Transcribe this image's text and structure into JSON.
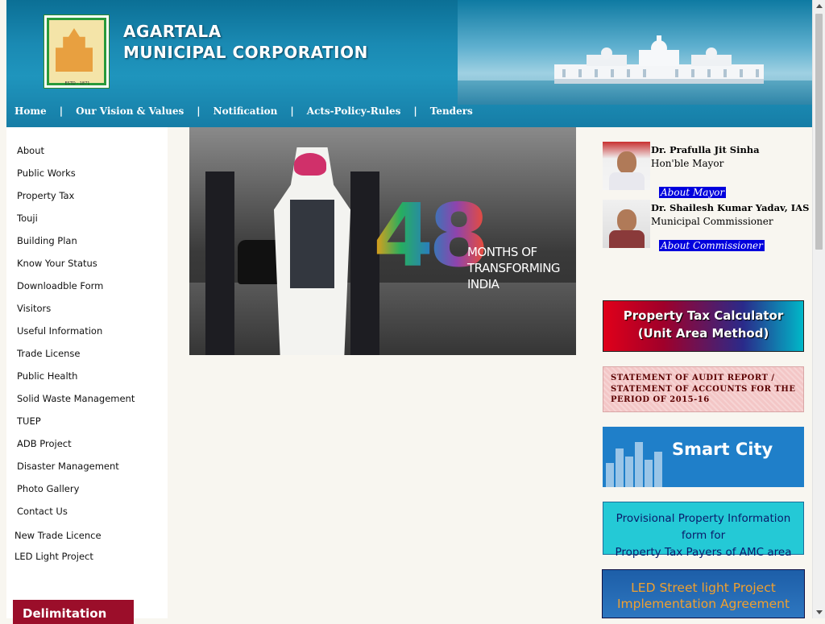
{
  "header": {
    "title_line1": "AGARTALA",
    "title_line2": "MUNICIPAL CORPORATION",
    "logo_estd": "ESTD - 1871"
  },
  "topnav": [
    "Home",
    "Our Vision & Values",
    "Notification",
    "Acts-Policy-Rules",
    "Tenders"
  ],
  "leftnav": [
    "About",
    "Public Works",
    "Property Tax",
    "Touji",
    "Building Plan",
    "Know Your Status",
    "Downloadble Form",
    "Visitors",
    "Useful Information",
    "Trade License",
    "Public Health",
    "Solid Waste Management",
    "TUEP",
    "ADB Project",
    "Disaster Management",
    "Photo Gallery",
    "Contact Us"
  ],
  "leftnav_extra": [
    "New Trade Licence",
    "LED Light Project"
  ],
  "delimitation": "Delimitation",
  "banner": {
    "number": "48",
    "text_line1": "MONTHS OF",
    "text_line2": "TRANSFORMING",
    "text_line3": "INDIA"
  },
  "officials": [
    {
      "name": "Dr. Prafulla Jit Sinha",
      "role": "Hon'ble Mayor",
      "link": "About Mayor"
    },
    {
      "name": "Dr. Shailesh Kumar Yadav, IAS",
      "role": "Municipal Commissioner",
      "link": "About Commissioner"
    }
  ],
  "promos": {
    "tax_line1": "Property Tax Calculator",
    "tax_line2": "(Unit Area Method)",
    "audit_line1": "STATEMENT OF AUDIT REPORT /",
    "audit_line2": "STATEMENT OF ACCOUNTS FOR THE",
    "audit_line3": "PERIOD OF 2015-16",
    "smart_city": "Smart City",
    "prov_line1": "Provisional Property Information form for",
    "prov_line2": "Property Tax Payers of AMC area",
    "led_line1": "LED Street light Project",
    "led_line2": "Implementation Agreement"
  },
  "colors": {
    "header_blue": "#1a8ab3",
    "link_blue": "#0000dd",
    "delimitation_red": "#9b0e2a"
  }
}
